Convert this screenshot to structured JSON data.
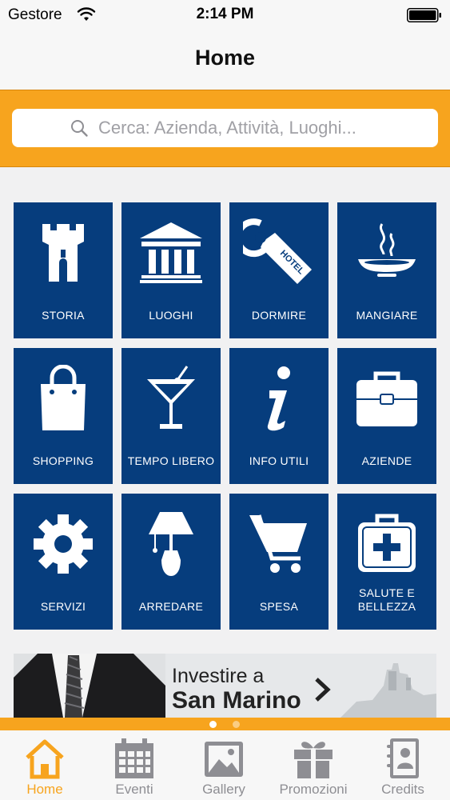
{
  "status_bar": {
    "carrier": "Gestore",
    "time": "2:14 PM"
  },
  "nav": {
    "title": "Home"
  },
  "search": {
    "placeholder": "Cerca: Azienda, Attività, Luoghi..."
  },
  "tiles": [
    {
      "label": "STORIA",
      "icon": "tower-icon"
    },
    {
      "label": "LUOGHI",
      "icon": "building-icon"
    },
    {
      "label": "DORMIRE",
      "icon": "hotel-tag-icon",
      "icon_text": "HOTEL"
    },
    {
      "label": "MANGIARE",
      "icon": "hot-dish-icon"
    },
    {
      "label": "SHOPPING",
      "icon": "shopping-bag-icon"
    },
    {
      "label": "TEMPO LIBERO",
      "icon": "cocktail-icon"
    },
    {
      "label": "INFO UTILI",
      "icon": "info-icon"
    },
    {
      "label": "AZIENDE",
      "icon": "briefcase-icon"
    },
    {
      "label": "SERVIZI",
      "icon": "gear-icon"
    },
    {
      "label": "ARREDARE",
      "icon": "lamp-icon"
    },
    {
      "label": "SPESA",
      "icon": "cart-icon"
    },
    {
      "label": "SALUTE E BELLEZZA",
      "icon": "first-aid-icon"
    }
  ],
  "banner": {
    "line1": "Investire a",
    "line2": "San Marino"
  },
  "pager": {
    "count": 2,
    "active": 0
  },
  "tabs": [
    {
      "label": "Home",
      "icon": "home-icon",
      "active": true
    },
    {
      "label": "Eventi",
      "icon": "calendar-icon",
      "active": false
    },
    {
      "label": "Gallery",
      "icon": "picture-icon",
      "active": false
    },
    {
      "label": "Promozioni",
      "icon": "gift-icon",
      "active": false
    },
    {
      "label": "Credits",
      "icon": "contacts-book-icon",
      "active": false
    }
  ],
  "colors": {
    "accent": "#f7a41e",
    "tile_bg": "#063d7d",
    "tab_inactive": "#8e8e93"
  }
}
